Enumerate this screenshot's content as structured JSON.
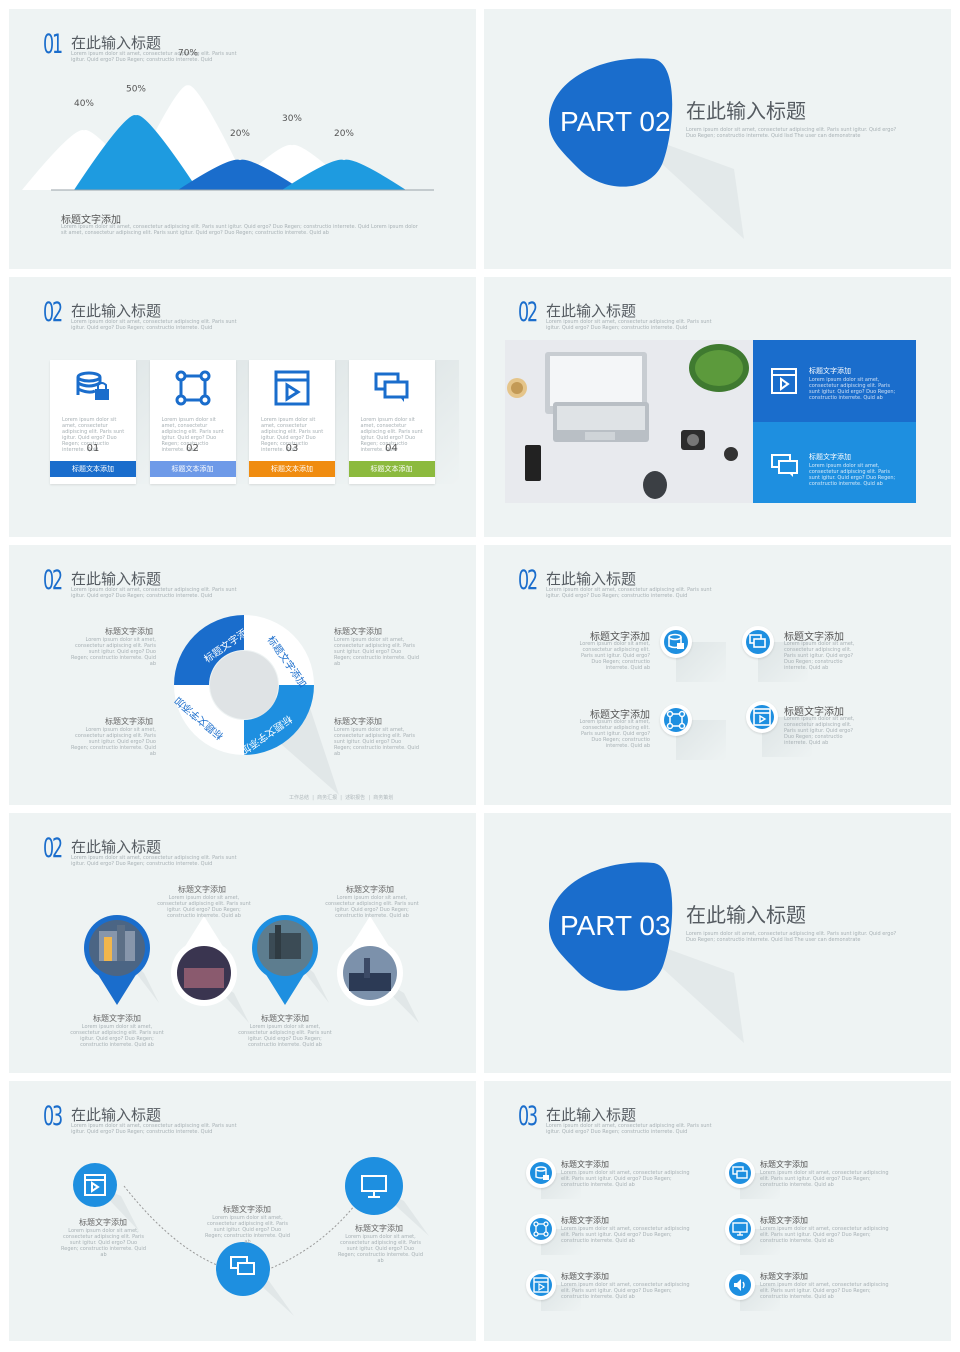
{
  "slide_title": "在此输入标题",
  "desc_short": "Lorem ipsum dolor sit amet, consectetur adipiscing elit. Paris sunt igitur. Quid ergo? Duo Regen; constructio interrete. Quid",
  "section_labels": {
    "s1": "01",
    "s2": "02",
    "s3": "03"
  },
  "chart": {
    "percent_labels": [
      "40%",
      "50%",
      "70%",
      "20%",
      "30%",
      "20%"
    ],
    "caption": "标题文字添加",
    "caption_desc": "Lorem ipsum dolor sit amet, consectetur adipiscing elit. Paris sunt igitur. Quid ergo? Duo Regen; constructio interrete. Quid Lorem ipsum dolor sit amet, consectetur adipiscing elit. Paris sunt igitur. Quid ergo? Duo Regen; constructio interrete. Quid ab"
  },
  "chart_data": {
    "type": "area",
    "categories": [
      "1",
      "2",
      "3",
      "4",
      "5",
      "6"
    ],
    "values": [
      40,
      50,
      70,
      20,
      30,
      20
    ],
    "colors": [
      "#ffffff",
      "#1e9be0",
      "#ffffff",
      "#1a6dcc",
      "#ffffff",
      "#1e9be0"
    ]
  },
  "part2": {
    "label": "PART 02",
    "title": "在此输入标题",
    "desc": "Lorem ipsum dolor sit amet, consectetur adipiscing elit. Paris sunt igitur. Quid ergo? Duo Regen; constructio interrete. Quid lisd The user can demonstrate"
  },
  "part3": {
    "label": "PART 03",
    "title": "在此输入标题",
    "desc": "Lorem ipsum dolor sit amet, consectetur adipiscing elit. Paris sunt igitur. Quid ergo? Duo Regen; constructio interrete. Quid lisd The user can demonstrate"
  },
  "cards": [
    {
      "num": "01",
      "label": "标题文本添加",
      "color": "#1a6dcc",
      "icon": "database-lock-icon"
    },
    {
      "num": "02",
      "label": "标题文本添加",
      "color": "#6e9ae8",
      "icon": "network-nodes-icon"
    },
    {
      "num": "03",
      "label": "标题文本添加",
      "color": "#f08c10",
      "icon": "video-window-icon"
    },
    {
      "num": "04",
      "label": "标题文本添加",
      "color": "#8cba3e",
      "icon": "chat-bubbles-icon"
    }
  ],
  "card_desc": "Lorem ipsum dolor sit amet, consectetur adipiscing elit. Paris sunt igitur. Quid ergo? Duo Regen; constructio interrete. Quid",
  "photo_panel": {
    "items": [
      {
        "title": "标题文字添加",
        "desc": "Lorem ipsum dolor sit amet, consectetur adipiscing elit. Paris sunt igitur. Quid ergo? Duo Regen; constructio interrete. Quid ab"
      },
      {
        "title": "标题文字添加",
        "desc": "Lorem ipsum dolor sit amet, consectetur adipiscing elit. Paris sunt igitur. Quid ergo? Duo Regen; constructio interrete. Quid ab"
      }
    ]
  },
  "ring": {
    "segment_label": "标题文字添加",
    "side_labels": [
      "标题文字添加",
      "标题文字添加",
      "标题文字添加",
      "标题文字添加"
    ],
    "side_desc": "Lorem ipsum dolor sit amet, consectetur adipiscing elit. Paris sunt igitur. Quid ergo? Duo Regen; constructio interrete. Quid ab",
    "footer": [
      "工作总结",
      "商务汇报",
      "述职报告",
      "商务策划"
    ]
  },
  "icon_grid": {
    "label": "标题文字添加",
    "desc": "Lorem ipsum dolor sit amet, consectetur adipiscing elit. Paris sunt igitur. Quid ergo? Duo Regen; constructio interrete. Quid ab"
  },
  "pins": {
    "label": "标题文字添加",
    "desc": "Lorem ipsum dolor sit amet, consectetur adipiscing elit. Paris sunt igitur. Quid ergo? Duo Regen; constructio interrete. Quid ab"
  },
  "flow": {
    "label": "标题文字添加",
    "desc": "Lorem ipsum dolor sit amet, consectetur adipiscing elit. Paris sunt igitur. Quid ergo? Duo Regen; constructio interrete. Quid ab"
  },
  "list6": {
    "label": "标题文字添加",
    "desc": "Lorem ipsum dolor sit amet, consectetur adipiscing elit. Paris sunt igitur. Quid ergo? Duo Regen; constructio interrete. Quid ab"
  }
}
